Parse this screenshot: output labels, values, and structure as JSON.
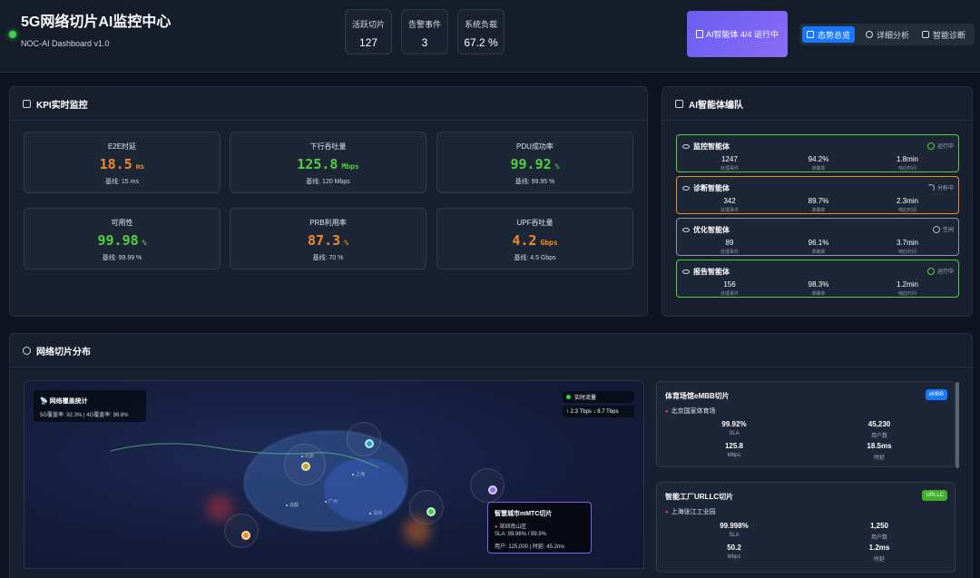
{
  "header": {
    "title": "5G网络切片AI监控中心",
    "subtitle": "NOC-AI Dashboard v1.0",
    "stats": [
      {
        "label": "活跃切片",
        "value": "127"
      },
      {
        "label": "告警事件",
        "value": "3"
      },
      {
        "label": "系统负载",
        "value": "67.2 %"
      }
    ],
    "agent_status": "AI智能体 4/4 运行中",
    "tabs": [
      "态势总览",
      "详细分析",
      "智能诊断"
    ]
  },
  "kpi": {
    "title": "KPI实时监控",
    "cards": [
      {
        "label": "E2E时延",
        "value": "18.5",
        "unit": "ms",
        "baseline": "基线: 15 ms"
      },
      {
        "label": "下行吞吐量",
        "value": "125.8",
        "unit": "Mbps",
        "baseline": "基线: 120 Mbps"
      },
      {
        "label": "PDU成功率",
        "value": "99.92",
        "unit": "%",
        "baseline": "基线: 99.95 %"
      },
      {
        "label": "可用性",
        "value": "99.98",
        "unit": "%",
        "baseline": "基线: 99.99 %"
      },
      {
        "label": "PRB利用率",
        "value": "87.3",
        "unit": "%",
        "baseline": "基线: 70 %"
      },
      {
        "label": "UPF吞吐量",
        "value": "4.2",
        "unit": "Gbps",
        "baseline": "基线: 4.5 Gbps"
      }
    ]
  },
  "agents": {
    "title": "AI智能体编队",
    "col_labels": [
      "处理事件",
      "准确率",
      "响应时间"
    ],
    "items": [
      {
        "name": "监控智能体",
        "status": "运行中",
        "events": "1247",
        "accuracy": "94.2%",
        "response": "1.8min"
      },
      {
        "name": "诊断智能体",
        "status": "分析中",
        "events": "342",
        "accuracy": "89.7%",
        "response": "2.3min"
      },
      {
        "name": "优化智能体",
        "status": "空闲",
        "events": "89",
        "accuracy": "96.1%",
        "response": "3.7min"
      },
      {
        "name": "报告智能体",
        "status": "运行中",
        "events": "156",
        "accuracy": "98.3%",
        "response": "1.2min"
      }
    ]
  },
  "distribution": {
    "title": "网络切片分布",
    "coverage_title": "网络覆盖统计",
    "coverage_text": "5G覆盖率: 92.3% | 4G覆盖率: 99.8%",
    "traffic_label": "实时流量",
    "traffic_text": "↑ 2.3 Tbps ↓ 8.7 Tbps",
    "cities": [
      "北京",
      "上海",
      "广州",
      "成都",
      "深圳"
    ],
    "tooltip": {
      "name": "智慧城市mMTC切片",
      "location": "深圳南山区",
      "sla": "SLA: 99.96% / 99.9%",
      "users": "用户: 125,000 | 时延: 45.2ms"
    },
    "slices": [
      {
        "name": "体育场馆eMBB切片",
        "badge": "eMBB",
        "location": "北京国家体育场",
        "sla": "99.92%",
        "users": "45,230",
        "throughput": "125.8",
        "latency": "18.5ms",
        "labels": [
          "SLA",
          "用户数",
          "Mbps",
          "时延"
        ]
      },
      {
        "name": "智能工厂URLLC切片",
        "badge": "URLLC",
        "location": "上海张江工业园",
        "sla": "99.998%",
        "users": "1,250",
        "throughput": "50.2",
        "latency": "1.2ms",
        "labels": [
          "SLA",
          "用户数",
          "Mbps",
          "时延"
        ]
      }
    ]
  },
  "colors": {
    "accent": "#1677ff",
    "ok": "#4fd13a",
    "warn": "#f08a24",
    "purple": "#7b62f3"
  }
}
